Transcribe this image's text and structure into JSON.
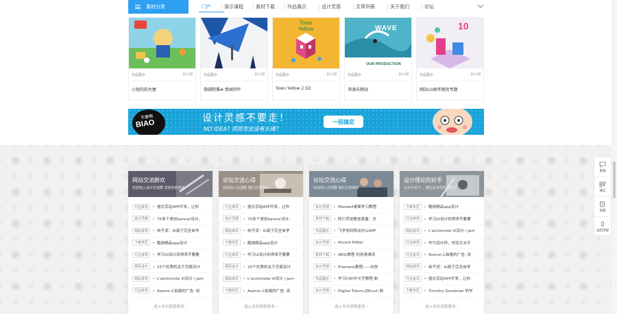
{
  "nav": {
    "category_label": "素材分类",
    "items": [
      {
        "label": "门户",
        "active": true
      },
      {
        "label": "源示课程",
        "active": false
      },
      {
        "label": "素材下载",
        "active": false
      },
      {
        "label": "作品展示",
        "active": false
      },
      {
        "label": "设计灵感",
        "active": false
      },
      {
        "label": "文章列表",
        "active": false
      },
      {
        "label": "关于我们",
        "active": false
      },
      {
        "label": "论坛",
        "active": false
      }
    ]
  },
  "works": [
    {
      "category": "作品展示",
      "date": "01-29",
      "title": "小短的的大屋"
    },
    {
      "category": "作品展示",
      "date": "01-29",
      "title": "骨田院事#·意国列午"
    },
    {
      "category": "作品展示",
      "date": "01-29",
      "title": "Town Yellow 2.5D"
    },
    {
      "category": "作品展示",
      "date": "01-29",
      "title": "冲浪乐网站"
    },
    {
      "category": "作品展示",
      "date": "01-29",
      "title": "网站10周年网页专题"
    }
  ],
  "thumb_text": {
    "town_title": "Town Yellow",
    "wave_title": "WAVE",
    "wave_sub": "OUR PRODUCTION",
    "num_title": "10"
  },
  "banner": {
    "bubble_small": "不要啊",
    "bubble_big": "BIAO",
    "headline": "设计灵感不要走！",
    "subline": "NO IDEA? 项目完全没有头绪？",
    "cta": "一招搞定"
  },
  "panels": [
    {
      "title": "网站交流群欢",
      "subtitle": "欢迎加入设计交流群 欢迎你的到来",
      "accent": "#5b5b6a",
      "rows": [
        {
          "tag": "行业资讯",
          "text": "插交京站APP开发，让你"
        },
        {
          "tag": "设计灵感",
          "text": "70多个原创banner设计，"
        },
        {
          "tag": "网站资讯",
          "text": "纯干货：AI真于完全自学"
        },
        {
          "tag": "下载专区",
          "text": "酷游精品app设计"
        },
        {
          "tag": "行业资讯",
          "text": "学习UI设计到得来不要要"
        },
        {
          "tag": "网页设计",
          "text": "25个优秀的关于页面设计"
        },
        {
          "tag": "网站资讯",
          "text": "L'alchimiste VI设计 / Jam"
        },
        {
          "tag": "行业资讯",
          "text": "Asonor上拍格的广告: 说"
        }
      ],
      "more": "进入专栏获取更多 ›"
    },
    {
      "title": "论坛交流心得",
      "subtitle": "欢迎加入交流群 我们分享相关",
      "accent": "#9a8f86",
      "rows": [
        {
          "tag": "行业资讯",
          "text": "插交京站APP开发，让你"
        },
        {
          "tag": "设计灵感",
          "text": "70多个原创banner设计，"
        },
        {
          "tag": "网站资讯",
          "text": "纯干货：AI真于完全自学"
        },
        {
          "tag": "下载专区",
          "text": "酷游精品app设计"
        },
        {
          "tag": "行业资讯",
          "text": "学习UI设计到得来不要要"
        },
        {
          "tag": "网页设计",
          "text": "25个优秀的关于页面设计"
        },
        {
          "tag": "网站资讯",
          "text": "L'alchimiste VI设计 / Jam"
        },
        {
          "tag": "下载专区",
          "text": "Asonor上拍格的广告: 说"
        }
      ],
      "more": "进入专栏获取更多 ›"
    },
    {
      "title": "论坛交流心得",
      "subtitle": "欢迎加入交流群 我们分享相关",
      "accent": "#7c8a98",
      "rows": [
        {
          "tag": "设计灵感",
          "text": "Maxwell桌面学习教程"
        },
        {
          "tag": "素材下载",
          "text": "阿仁苹说教信息量：总"
        },
        {
          "tag": "作品展示",
          "text": "飞学协同移动办公APP"
        },
        {
          "tag": "设计灵感",
          "text": "Accent Rifkel"
        },
        {
          "tag": "素材下载",
          "text": "AEIG教程 利用滑滑添"
        },
        {
          "tag": "设计灵感",
          "text": "Premiere教程——向你"
        },
        {
          "tag": "作品展示",
          "text": "学习C4D中文字教程 制"
        },
        {
          "tag": "设计灵感",
          "text": "Digital Tutors-ZBrush 制"
        }
      ],
      "more": "进入专栏获取更多 ›"
    },
    {
      "title": "设计理论的好手",
      "subtitle": "大大与天下 ，通过业专论好的好手",
      "accent": "#8d959b",
      "rows": [
        {
          "tag": "下载专区",
          "text": "酷游精品app设计"
        },
        {
          "tag": "行业资讯",
          "text": "学习UI设计到得来不要要"
        },
        {
          "tag": "网站资讯",
          "text": "L'alchimiste VI设计 / Jam"
        },
        {
          "tag": "行业资讯",
          "text": "作为设计师，你没文水平"
        },
        {
          "tag": "行业资讯",
          "text": "Asonor上拍格的广告: 说"
        },
        {
          "tag": "网站资讯",
          "text": "纯干货：AI真于完全自学"
        },
        {
          "tag": "行业资讯",
          "text": "插交京站APP开发，让你"
        },
        {
          "tag": "下载专区",
          "text": "Timothy Goodman 的学"
        }
      ],
      "more": "进入专栏获取更多 ›"
    }
  ],
  "sidebar": {
    "items": [
      {
        "label": "客服",
        "icon": "chat-icon"
      },
      {
        "label": "微信",
        "icon": "qrcode-icon"
      },
      {
        "label": "投稿",
        "icon": "edit-icon"
      },
      {
        "label": "返回顶部",
        "icon": "rocket-icon"
      }
    ]
  },
  "colors": {
    "accent": "#2ea0f2",
    "banner": "#1aa3d8"
  }
}
